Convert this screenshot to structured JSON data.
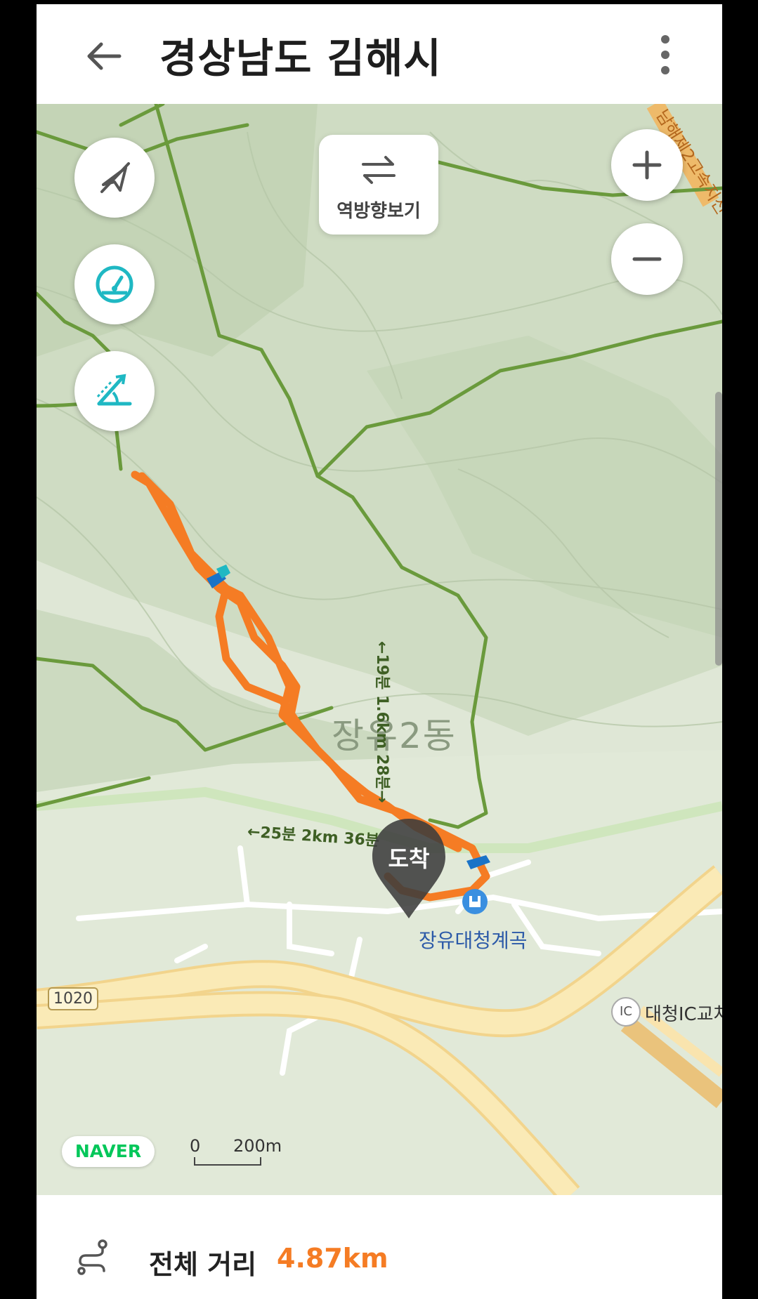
{
  "header": {
    "title": "경상남도 김해시"
  },
  "map": {
    "reverse_button_label": "역방향보기",
    "area_label": "장유2동",
    "poi_label": "장유대청계곡",
    "ic_badge": "IC",
    "ic_label": "대청IC교차",
    "road_number": "1020",
    "highway_label": "남해제2고속지선",
    "trail_label_right": "←19분 1.6km 28분→",
    "trail_label_left": "←25분 2km 36분",
    "arrival_marker": "도착",
    "logo": "NAVER",
    "scale_start": "0",
    "scale_end": "200m",
    "colors": {
      "route": "#f57c24",
      "trail": "#6a9a3c",
      "accent": "#1fb8c3",
      "road": "#f5e6a8"
    }
  },
  "footer": {
    "distance_label": "전체 거리",
    "distance_value": "4.87km"
  }
}
